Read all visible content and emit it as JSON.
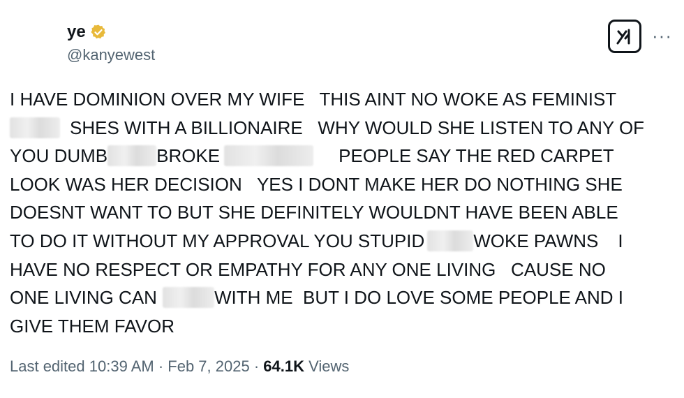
{
  "author": {
    "display_name": "ye",
    "handle": "@kanyewest",
    "verified_badge_icon": "verified-gold-badge-icon",
    "badge_color": "#e8b93a"
  },
  "actions": {
    "grok_icon": "grok-icon",
    "more_icon": "more-icon",
    "more_label": "···"
  },
  "tweet": {
    "lines": [
      [
        "I HAVE DOMINION OVER MY WIFE   THIS AINT NO WOKE AS FEMINIST"
      ],
      [
        "",
        "SHES WITH A BILLIONAIRE   WHY WOULD SHE LISTEN TO ANY OF"
      ],
      [
        "YOU DUMB",
        "BROKE",
        "PEOPLE SAY THE RED CARPET"
      ],
      [
        "LOOK WAS HER DECISION   YES I DONT MAKE HER DO NOTHING SHE"
      ],
      [
        "DOESNT WANT TO BUT SHE DEFINITELY WOULDNT HAVE BEEN ABLE"
      ],
      [
        "TO DO IT WITHOUT MY APPROVAL YOU STUPID",
        "WOKE PAWNS",
        "I"
      ],
      [
        "HAVE NO RESPECT OR EMPATHY FOR ANY ONE LIVING   CAUSE NO"
      ],
      [
        "ONE LIVING CAN",
        "WITH ME  BUT I DO LOVE SOME PEOPLE AND I"
      ],
      [
        "GIVE THEM FAVOR"
      ]
    ]
  },
  "meta": {
    "edited": "Last edited 10:39 AM",
    "sep1": " · ",
    "date": "Feb 7, 2025",
    "sep2": " · ",
    "views_count": "64.1K",
    "views_label": " Views"
  }
}
